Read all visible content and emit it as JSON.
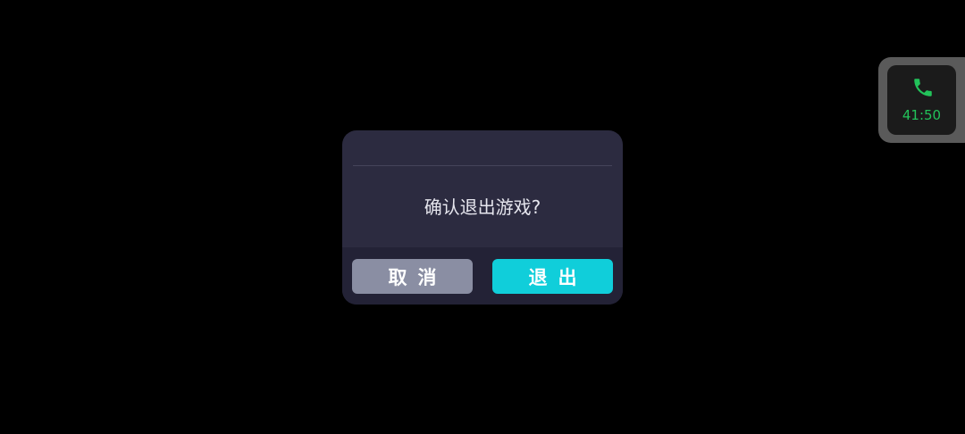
{
  "dialog": {
    "message": "确认退出游戏?",
    "cancel_label": "取消",
    "exit_label": "退出"
  },
  "call_widget": {
    "icon": "phone-icon",
    "duration": "41:50",
    "accent_color": "#22c35a"
  },
  "colors": {
    "background": "#000000",
    "dialog_bg": "#2c2b40",
    "cancel_button": "#8a8ea3",
    "exit_button": "#10ceda"
  }
}
